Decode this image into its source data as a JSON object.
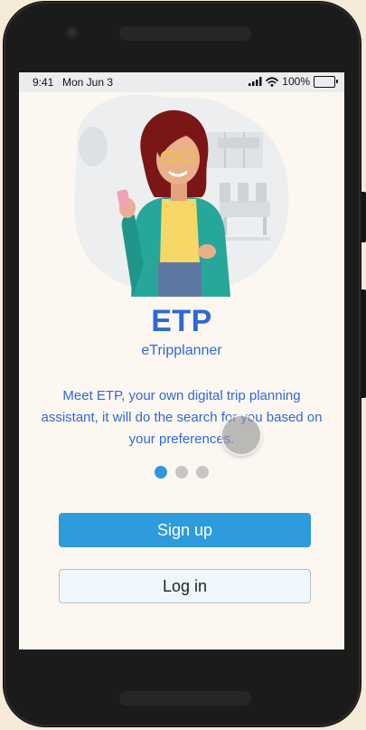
{
  "status_bar": {
    "time": "9:41",
    "date": "Mon Jun 3",
    "battery_percent": "100%"
  },
  "brand": {
    "title": "ETP",
    "subtitle": "eTripplanner"
  },
  "onboarding": {
    "description": "Meet ETP, your own digital trip planning assistant, it will do the search for you based on your preferences.",
    "page_indicator": {
      "total": 3,
      "active_index": 0
    }
  },
  "actions": {
    "signup_label": "Sign up",
    "login_label": "Log in"
  },
  "colors": {
    "brand_blue": "#2f68d6",
    "primary_button": "#2d9bdc",
    "active_dot": "#3097db",
    "inactive_dot": "#c6c6c6",
    "screen_background": "#fcf8f1",
    "device_frame": "#1b1b1b",
    "page_background": "#f6ead8"
  },
  "icons": {
    "signal": "cellular-signal-icon",
    "wifi": "wifi-icon",
    "battery": "battery-icon"
  }
}
